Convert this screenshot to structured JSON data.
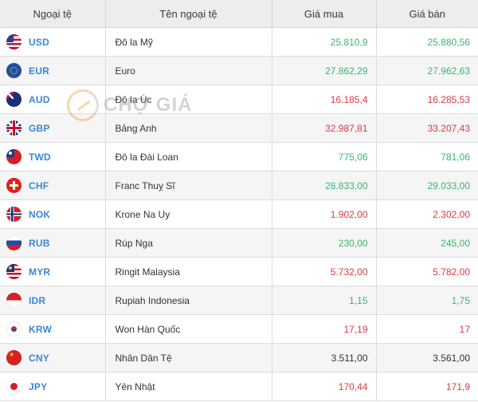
{
  "table": {
    "headers": {
      "code": "Ngoại tệ",
      "name": "Tên ngoại tệ",
      "buy": "Giá mua",
      "sell": "Giá bán"
    },
    "rows": [
      {
        "code": "USD",
        "name": "Đô la Mỹ",
        "buy": "25.810,9",
        "sell": "25.880,56",
        "trend": "up",
        "flag_icon": "us-flag-icon"
      },
      {
        "code": "EUR",
        "name": "Euro",
        "buy": "27.862,29",
        "sell": "27.962,63",
        "trend": "up",
        "flag_icon": "eu-flag-icon"
      },
      {
        "code": "AUD",
        "name": "Đô la Úc",
        "buy": "16.185,4",
        "sell": "16.285,53",
        "trend": "down",
        "flag_icon": "au-flag-icon"
      },
      {
        "code": "GBP",
        "name": "Bảng Anh",
        "buy": "32.987,81",
        "sell": "33.207,43",
        "trend": "down",
        "flag_icon": "uk-flag-icon"
      },
      {
        "code": "TWD",
        "name": "Đô la Đài Loan",
        "buy": "775,06",
        "sell": "781,06",
        "trend": "up",
        "flag_icon": "tw-flag-icon"
      },
      {
        "code": "CHF",
        "name": "Franc Thuỵ Sĩ",
        "buy": "28.833,00",
        "sell": "29.033,00",
        "trend": "up",
        "flag_icon": "ch-flag-icon"
      },
      {
        "code": "NOK",
        "name": "Krone Na Uy",
        "buy": "1.902,00",
        "sell": "2.302,00",
        "trend": "down",
        "flag_icon": "no-flag-icon"
      },
      {
        "code": "RUB",
        "name": "Rúp Nga",
        "buy": "230,00",
        "sell": "245,00",
        "trend": "up",
        "flag_icon": "ru-flag-icon"
      },
      {
        "code": "MYR",
        "name": "Ringit Malaysia",
        "buy": "5.732,00",
        "sell": "5.782,00",
        "trend": "down",
        "flag_icon": "my-flag-icon"
      },
      {
        "code": "IDR",
        "name": "Rupiah Indonesia",
        "buy": "1,15",
        "sell": "1,75",
        "trend": "up",
        "flag_icon": "id-flag-icon"
      },
      {
        "code": "KRW",
        "name": "Won Hàn Quốc",
        "buy": "17,19",
        "sell": "17",
        "trend": "down",
        "flag_icon": "kr-flag-icon"
      },
      {
        "code": "CNY",
        "name": "Nhân Dân Tệ",
        "buy": "3.511,00",
        "sell": "3.561,00",
        "trend": "same",
        "flag_icon": "cn-flag-icon"
      },
      {
        "code": "JPY",
        "name": "Yên Nhật",
        "buy": "170,44",
        "sell": "171,9",
        "trend": "down",
        "flag_icon": "jp-flag-icon"
      }
    ]
  },
  "watermark": {
    "text": "CHỢ GIÁ"
  },
  "colors": {
    "up": "#3cb371",
    "down": "#e0383e",
    "same": "#333333",
    "code": "#3d85d6",
    "header_bg": "#ededed"
  }
}
